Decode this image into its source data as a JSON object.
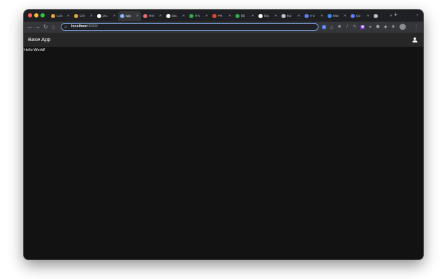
{
  "browser": {
    "tabs": [
      {
        "label": "Con",
        "icon": "chrome-icon",
        "color": "#e2a33b"
      },
      {
        "label": "Chr",
        "icon": "chrome-icon",
        "color": "#e2a33b"
      },
      {
        "label": "pru",
        "icon": "github-icon",
        "color": "#ffffff"
      },
      {
        "label": "app",
        "icon": "cloud-icon",
        "color": "#8ab4f8",
        "active": true
      },
      {
        "label": "Terr",
        "icon": "document-icon",
        "color": "#e06c75"
      },
      {
        "label": "bac",
        "icon": "github-icon",
        "color": "#ffffff"
      },
      {
        "label": "ITX",
        "icon": "sheets-icon",
        "color": "#34a853"
      },
      {
        "label": "PR",
        "icon": "gmail-icon",
        "color": "#ea4335"
      },
      {
        "label": "[B]",
        "icon": "sheets-icon",
        "color": "#34a853"
      },
      {
        "label": "bac",
        "icon": "github-icon",
        "color": "#ffffff"
      },
      {
        "label": "tsp",
        "icon": "compass-icon",
        "color": "#bdc1c6"
      },
      {
        "label": "v-d",
        "icon": "vuetify-icon",
        "color": "#5c7cfa"
      },
      {
        "label": "Mat",
        "icon": "docs-icon",
        "color": "#4285f4"
      },
      {
        "label": "Qu",
        "icon": "vuetify-icon",
        "color": "#5c7cfa"
      },
      {
        "label": "",
        "icon": "loading-icon",
        "color": "#bdc1c6"
      }
    ],
    "new_tab": "+",
    "tab_menu": "⌄",
    "url_host": "localhost",
    "url_path": ":8000/",
    "nav": {
      "back": "←",
      "forward": "→",
      "reload": "↻",
      "home": "⌂"
    },
    "menu": "⋮"
  },
  "app": {
    "title": "Base App"
  },
  "content": {
    "text": "Hello World!"
  }
}
